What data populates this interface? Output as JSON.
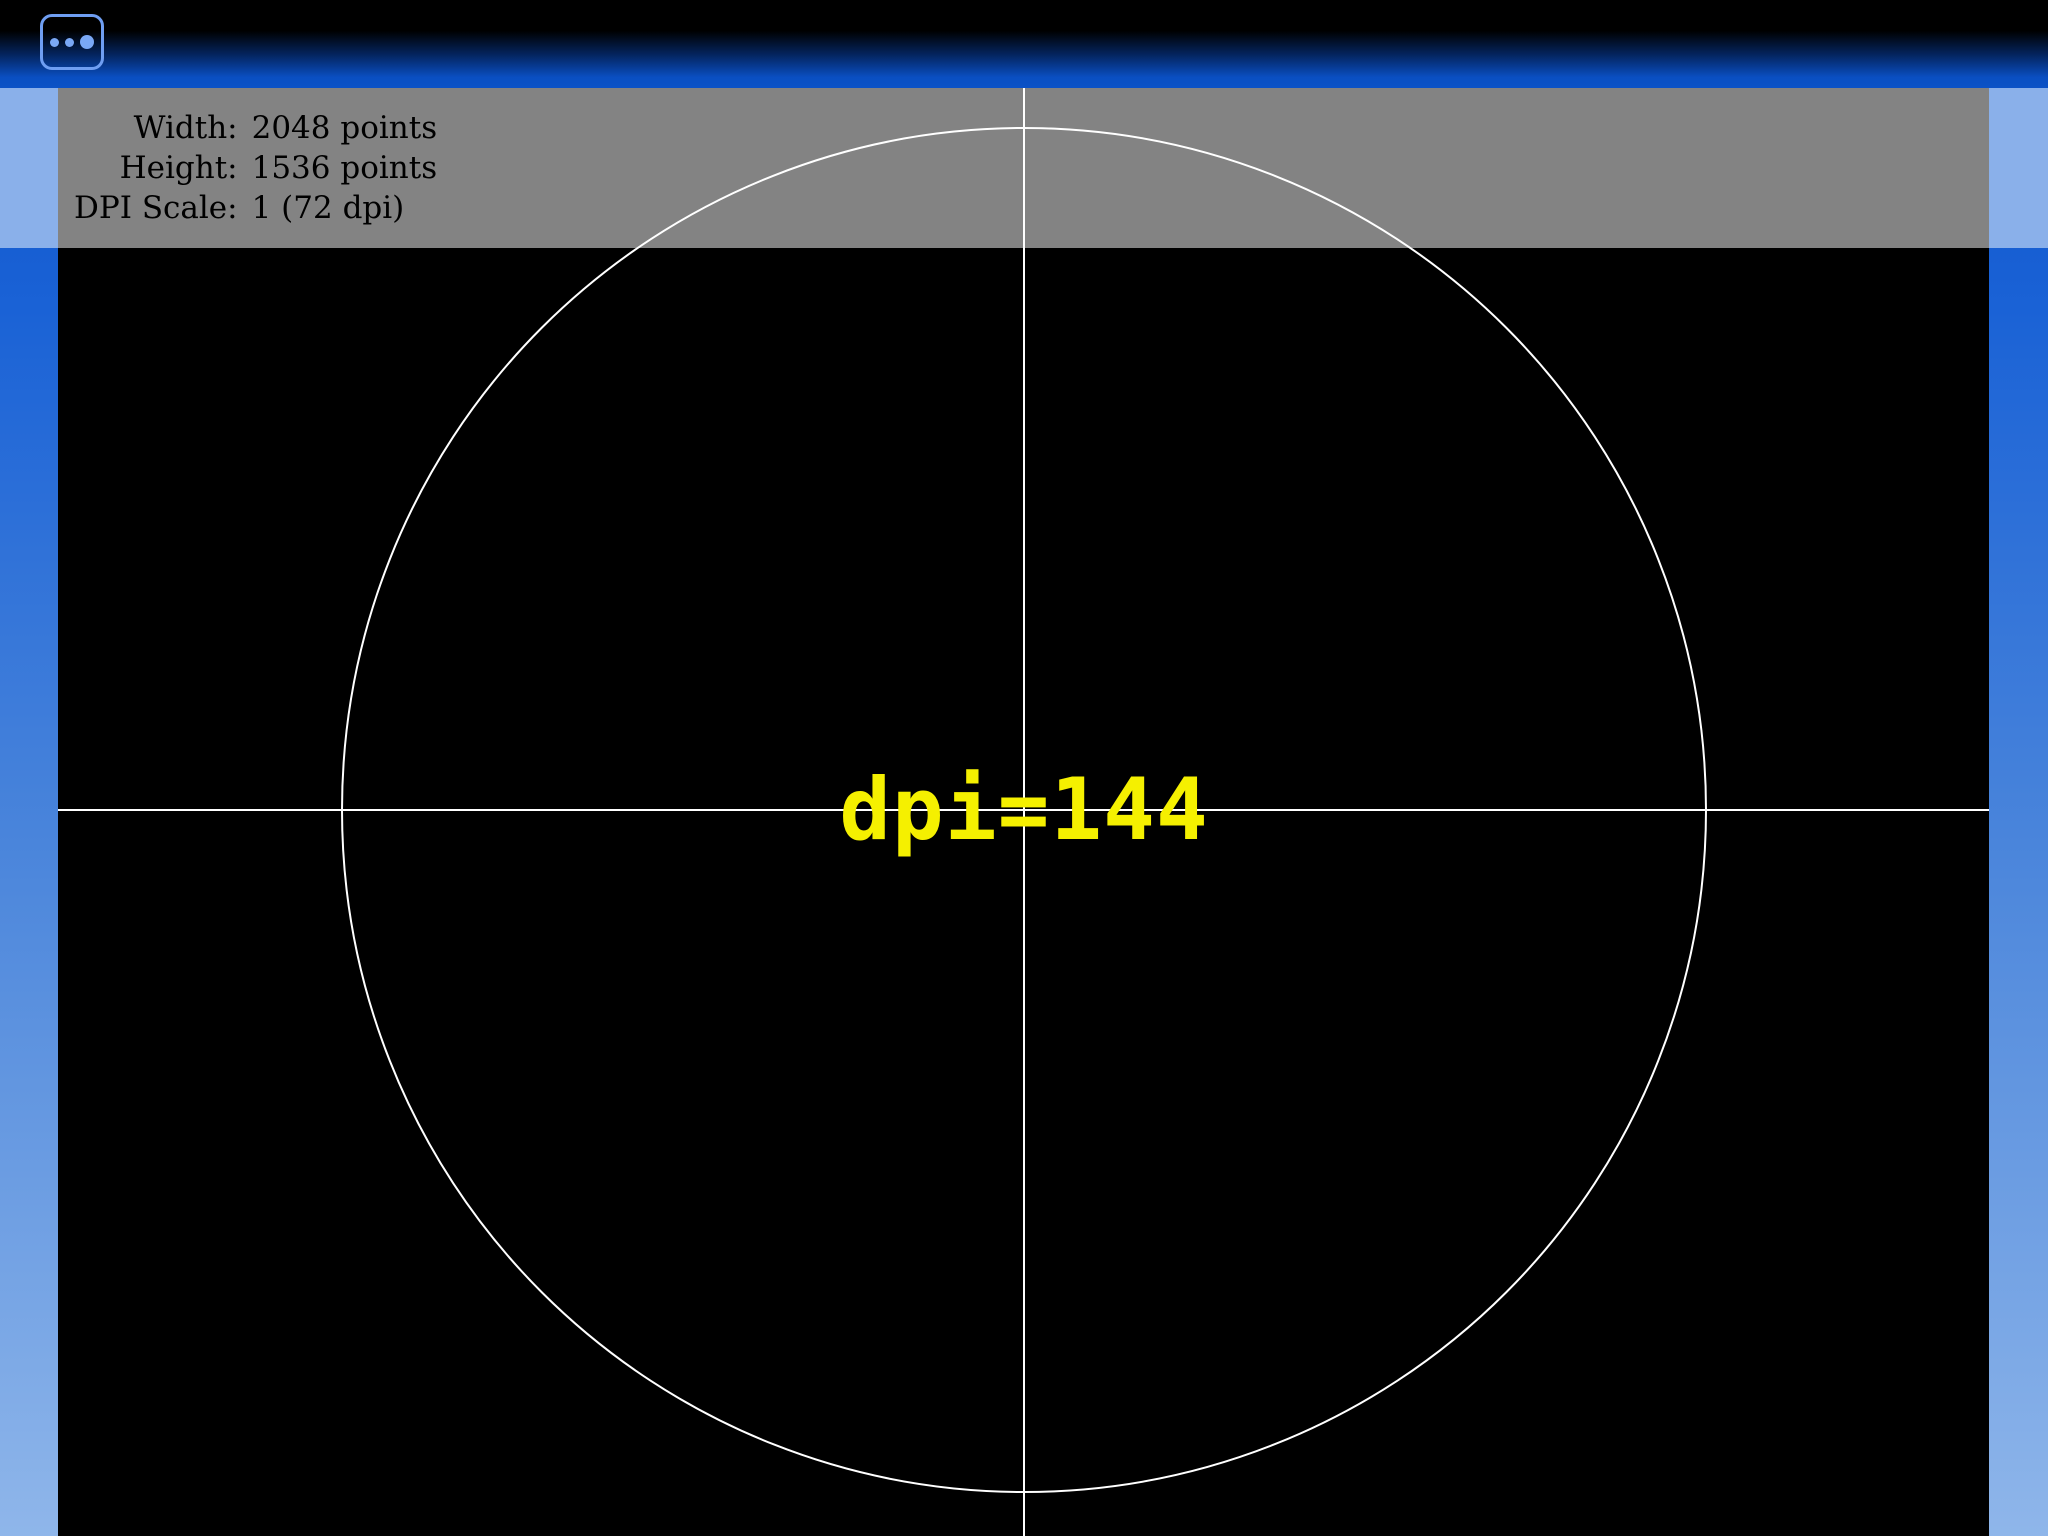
{
  "toolbar": {
    "menu_icon": "more-dots-icon"
  },
  "info": {
    "rows": [
      {
        "label": "Width:",
        "value": "2048 points"
      },
      {
        "label": "Height:",
        "value": "1536 points"
      },
      {
        "label": "DPI Scale:",
        "value": "1 (72 dpi)"
      }
    ]
  },
  "test_pattern": {
    "text": "dpi=144",
    "text_color": "#f5f000",
    "line_color": "#ffffff",
    "background_color": "#000000"
  }
}
